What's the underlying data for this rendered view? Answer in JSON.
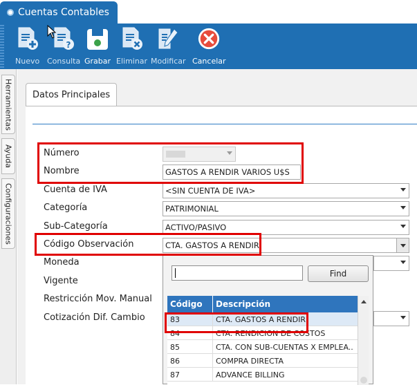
{
  "window": {
    "title": "Cuentas Contables"
  },
  "toolbar": {
    "nuevo": "Nuevo",
    "consulta": "Consulta",
    "grabar": "Grabar",
    "eliminar": "Eliminar",
    "modificar": "Modificar",
    "cancelar": "Cancelar"
  },
  "sidebar": {
    "herramientas": "Herramientas",
    "ayuda": "Ayuda",
    "configuraciones": "Configuraciones"
  },
  "panel": {
    "tab": "Datos Principales"
  },
  "form": {
    "numero": {
      "label": "Número",
      "value": ""
    },
    "nombre": {
      "label": "Nombre",
      "value": "GASTOS A RENDIR VARIOS U$S"
    },
    "cuenta_iva": {
      "label": "Cuenta de IVA",
      "value": "<SIN CUENTA DE IVA>"
    },
    "categoria": {
      "label": "Categoría",
      "value": "PATRIMONIAL"
    },
    "subcategoria": {
      "label": "Sub-Categoría",
      "value": "ACTIVO/PASIVO"
    },
    "codigo_obs": {
      "label": "Código Observación",
      "value": "CTA. GASTOS A RENDIR"
    },
    "moneda": {
      "label": "Moneda"
    },
    "vigente": {
      "label": "Vigente"
    },
    "restriccion": {
      "label": "Restricción Mov. Manual"
    },
    "cotizacion": {
      "label": "Cotización Dif. Cambio"
    }
  },
  "popup": {
    "find_label": "Find",
    "columns": [
      "Código",
      "Descripción"
    ],
    "rows": [
      {
        "codigo": "83",
        "descripcion": "CTA. GASTOS A RENDIR"
      },
      {
        "codigo": "84",
        "descripcion": "CTA. RENDICION DE COSTOS"
      },
      {
        "codigo": "85",
        "descripcion": "CTA. CON SUB-CUENTAS X EMPLEA..."
      },
      {
        "codigo": "86",
        "descripcion": "COMPRA DIRECTA"
      },
      {
        "codigo": "87",
        "descripcion": "ADVANCE BILLING"
      }
    ]
  },
  "colors": {
    "accent": "#1f6fb3",
    "highlight": "#e00000",
    "grid_header": "#2f75bd",
    "cancel": "#e74c3c"
  }
}
